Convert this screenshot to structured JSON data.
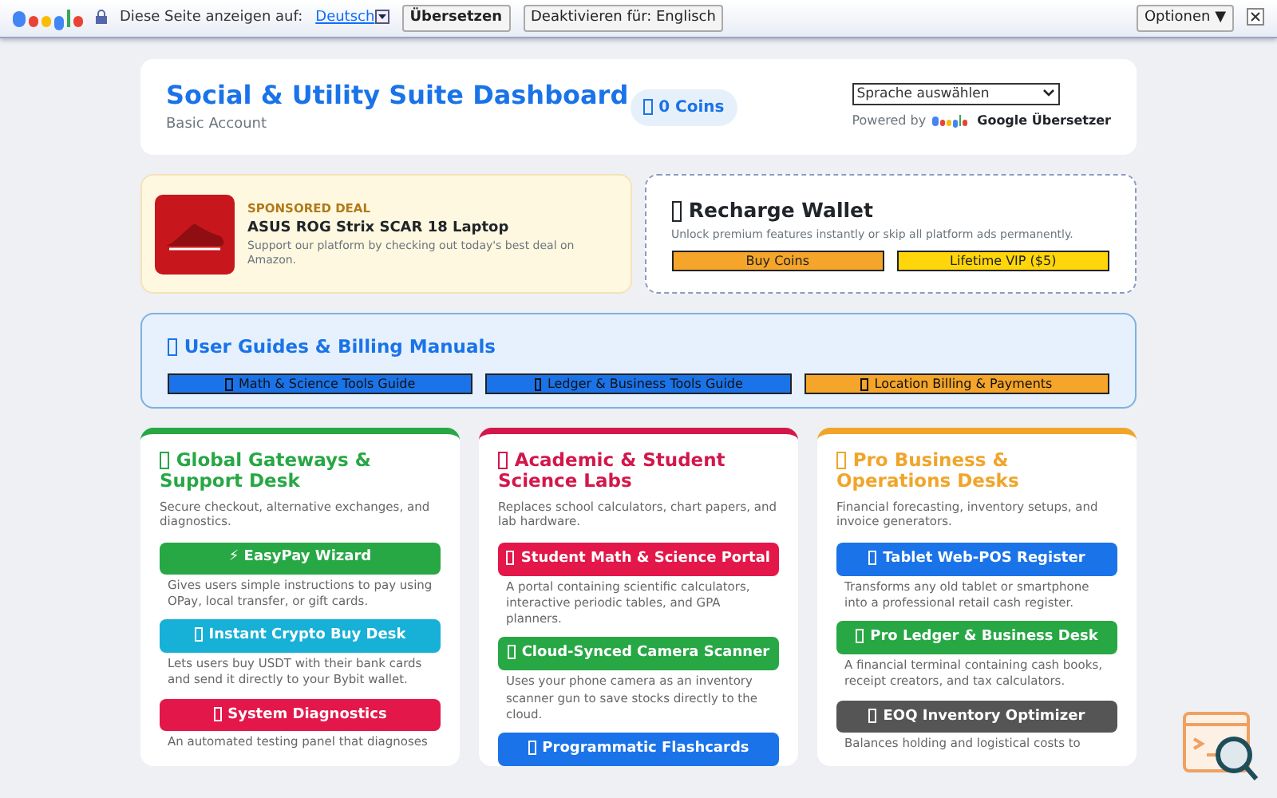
{
  "translate_bar": {
    "label": "Diese Seite anzeigen auf:",
    "language": "Deutsch",
    "translate_button": "Übersetzen",
    "disable_button": "Deaktivieren für: Englisch",
    "options_button": "Optionen ▼"
  },
  "header": {
    "title": "Social & Utility Suite Dashboard",
    "subtitle": "Basic Account",
    "coins": "0 Coins",
    "language_select": "Sprache auswählen",
    "powered_by": "Powered by",
    "translator": "Google Übersetzer"
  },
  "ad": {
    "label": "SPONSORED DEAL",
    "title": "ASUS ROG Strix SCAR 18 Laptop",
    "description": "Support our platform by checking out today's best deal on Amazon."
  },
  "wallet": {
    "title": "Recharge Wallet",
    "description": "Unlock premium features instantly or skip all platform ads permanently.",
    "buttons": [
      {
        "label": "Buy Coins",
        "color": "#f5a52a"
      },
      {
        "label": "Lifetime VIP ($5)",
        "color": "#ffd60a"
      }
    ]
  },
  "guides": {
    "title": "User Guides & Billing Manuals",
    "buttons": [
      {
        "label": "Math & Science Tools Guide",
        "color": "#1a73e8"
      },
      {
        "label": "Ledger & Business Tools Guide",
        "color": "#1a73e8"
      },
      {
        "label": "Location Billing & Payments",
        "color": "#f5a52a"
      }
    ]
  },
  "sections": [
    {
      "title": "Global Gateways & Support Desk",
      "color": "#28a745",
      "description": "Secure checkout, alternative exchanges, and diagnostics.",
      "tools": [
        {
          "label": "⚡ EasyPay Wizard",
          "kind": "plain",
          "color": "#28a745",
          "description": "Gives users simple instructions to pay using OPay, local transfer, or gift cards."
        },
        {
          "label": "Instant Crypto Buy Desk",
          "kind": "glyph",
          "color": "#17b0d6",
          "description": "Lets users buy USDT with their bank cards and send it directly to your Bybit wallet."
        },
        {
          "label": "System Diagnostics",
          "kind": "glyph",
          "color": "#e3174a",
          "description": "An automated testing panel that diagnoses"
        }
      ]
    },
    {
      "title": "Academic & Student Science Labs",
      "color": "#d3174a",
      "description": "Replaces school calculators, chart papers, and lab hardware.",
      "tools": [
        {
          "label": "Student Math & Science Portal",
          "kind": "glyph",
          "color": "#e3174a",
          "description": "A portal containing scientific calculators, interactive periodic tables, and GPA planners."
        },
        {
          "label": "Cloud-Synced Camera Scanner",
          "kind": "glyph",
          "color": "#28a745",
          "description": "Uses your phone camera as an inventory scanner gun to save stocks directly to the cloud."
        },
        {
          "label": "Programmatic Flashcards",
          "kind": "glyph",
          "color": "#1a73e8"
        }
      ]
    },
    {
      "title": "Pro Business & Operations Desks",
      "color": "#f0a52a",
      "description": "Financial forecasting, inventory setups, and invoice generators.",
      "tools": [
        {
          "label": "Tablet Web-POS Register",
          "kind": "glyph",
          "color": "#1a73e8",
          "description": "Transforms any old tablet or smartphone into a professional retail cash register."
        },
        {
          "label": "Pro Ledger & Business Desk",
          "kind": "glyph",
          "color": "#28a745",
          "description": "A financial terminal containing cash books, receipt creators, and tax calculators."
        },
        {
          "label": "EOQ Inventory Optimizer",
          "kind": "glyph",
          "color": "#555555",
          "description": "Balances holding and logistical costs to"
        }
      ]
    }
  ]
}
